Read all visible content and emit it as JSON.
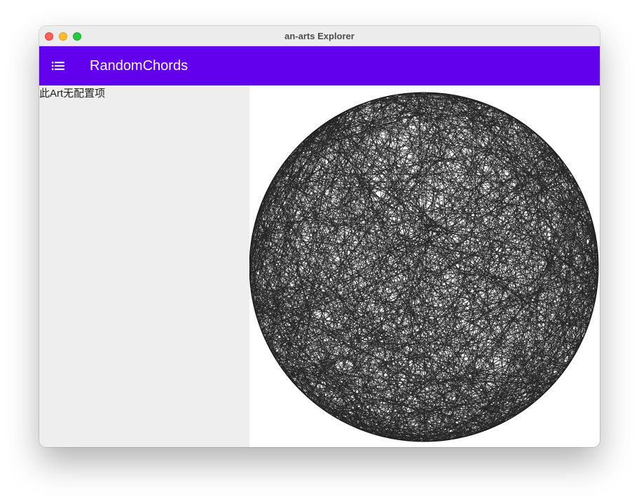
{
  "window": {
    "title": "an-arts Explorer"
  },
  "appbar": {
    "title": "RandomChords",
    "menu_icon": "menu-list-icon",
    "color": "#6200ee"
  },
  "sidebar": {
    "message": "此Art无配置项",
    "background": "#eeeeee"
  },
  "artwork": {
    "name": "RandomChords",
    "stroke_color": "#000000",
    "background": "#ffffff"
  },
  "colors": {
    "traffic_close": "#ff5f57",
    "traffic_minimize": "#febc2e",
    "traffic_zoom": "#28c840"
  }
}
